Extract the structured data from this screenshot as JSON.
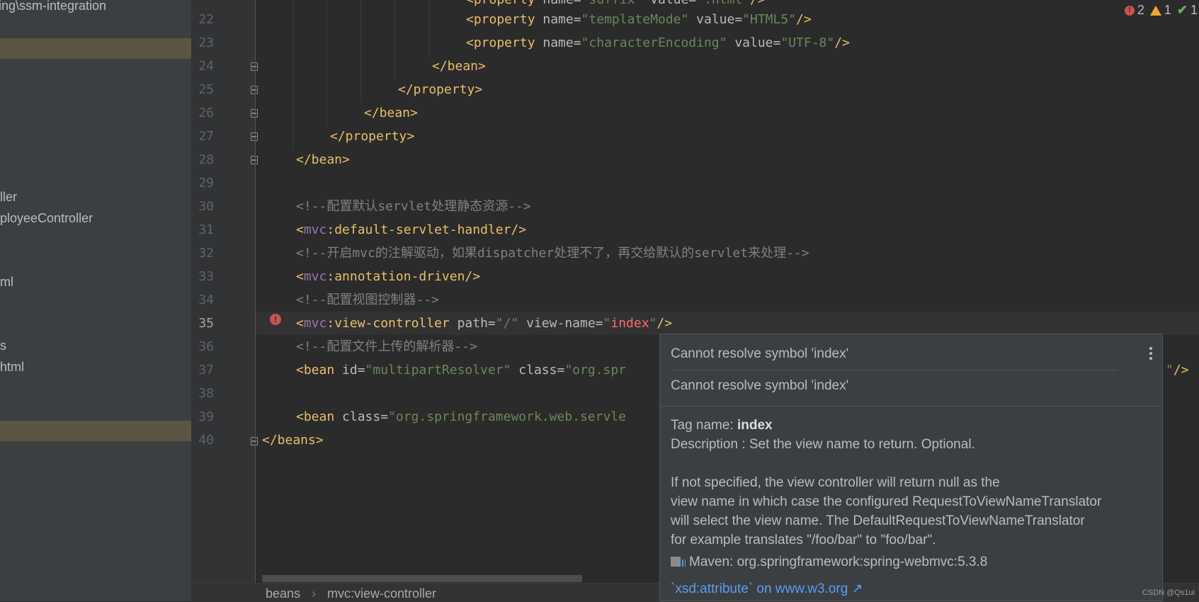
{
  "project": {
    "path_fragment": "ing\\ssm-integration",
    "items": [
      "ller",
      "ployeeController",
      "ml",
      "s",
      "html"
    ]
  },
  "status": {
    "errors": "2",
    "warnings": "1",
    "ok": "1"
  },
  "editor": {
    "line_numbers": [
      "22",
      "23",
      "24",
      "25",
      "26",
      "27",
      "28",
      "29",
      "30",
      "31",
      "32",
      "33",
      "34",
      "35",
      "36",
      "37",
      "38",
      "39",
      "40"
    ],
    "lines": {
      "l21": {
        "t1": "<property",
        "a1": " name=",
        "v1": "\"suffix\"",
        "a2": " value=",
        "v2": "\".html\"",
        "t2": "/>"
      },
      "l22": {
        "t1": "<property",
        "a1": " name=",
        "v1": "\"templateMode\"",
        "a2": " value=",
        "v2": "\"HTML5\"",
        "t2": "/>"
      },
      "l23": {
        "t1": "<property",
        "a1": " name=",
        "v1": "\"characterEncoding\"",
        "a2": " value=",
        "v2": "\"UTF-8\"",
        "t2": "/>"
      },
      "l24": "</bean>",
      "l25": "</property>",
      "l26": "</bean>",
      "l27": "</property>",
      "l28": "</bean>",
      "l30": "<!--配置默认servlet处理静态资源-->",
      "l31": {
        "lt": "<",
        "ns": "mvc",
        "rest": ":default-servlet-handler/>"
      },
      "l32": "<!--开启mvc的注解驱动，如果dispatcher处理不了，再交给默认的servlet来处理-->",
      "l33": {
        "lt": "<",
        "ns": "mvc",
        "rest": ":annotation-driven/>"
      },
      "l34": "<!--配置视图控制器-->",
      "l35": {
        "lt": "<",
        "ns": "mvc",
        "tag": ":view-controller",
        "a1": " path=",
        "v1": "\"/\"",
        "a2": " view-name=",
        "q1": "\"",
        "err": "index",
        "q2": "\"",
        "end": "/>"
      },
      "l36": "<!--配置文件上传的解析器-->",
      "l37": {
        "t1": "<bean",
        "a1": " id=",
        "v1": "\"multipartResolver\"",
        "a2": " class=",
        "v2": "\"org.spr",
        "tail": "\"/>"
      },
      "l39": {
        "t1": "<bean",
        "a1": " class=",
        "v1": "\"org.springframework.web.servle"
      },
      "l40": "</beans>"
    }
  },
  "breadcrumb": {
    "item1": "beans",
    "sep": "›",
    "item2": "mvc:view-controller"
  },
  "popup": {
    "error1": "Cannot resolve symbol 'index'",
    "error2": "Cannot resolve symbol 'index'",
    "tag_label": "Tag name: ",
    "tag_value": "index",
    "description": "Description : Set the view name to return. Optional.",
    "para1": "If not specified, the view controller will return null as the",
    "para2": "view name in which case the configured RequestToViewNameTranslator",
    "para3": "will select the view name. The DefaultRequestToViewNameTranslator",
    "para4": "for example translates \"/foo/bar\" to \"foo/bar\".",
    "maven": "Maven: org.springframework:spring-webmvc:5.3.8",
    "link": "`xsd:attribute` on www.w3.org ↗"
  },
  "watermark": "CSDN @Qs1ui"
}
